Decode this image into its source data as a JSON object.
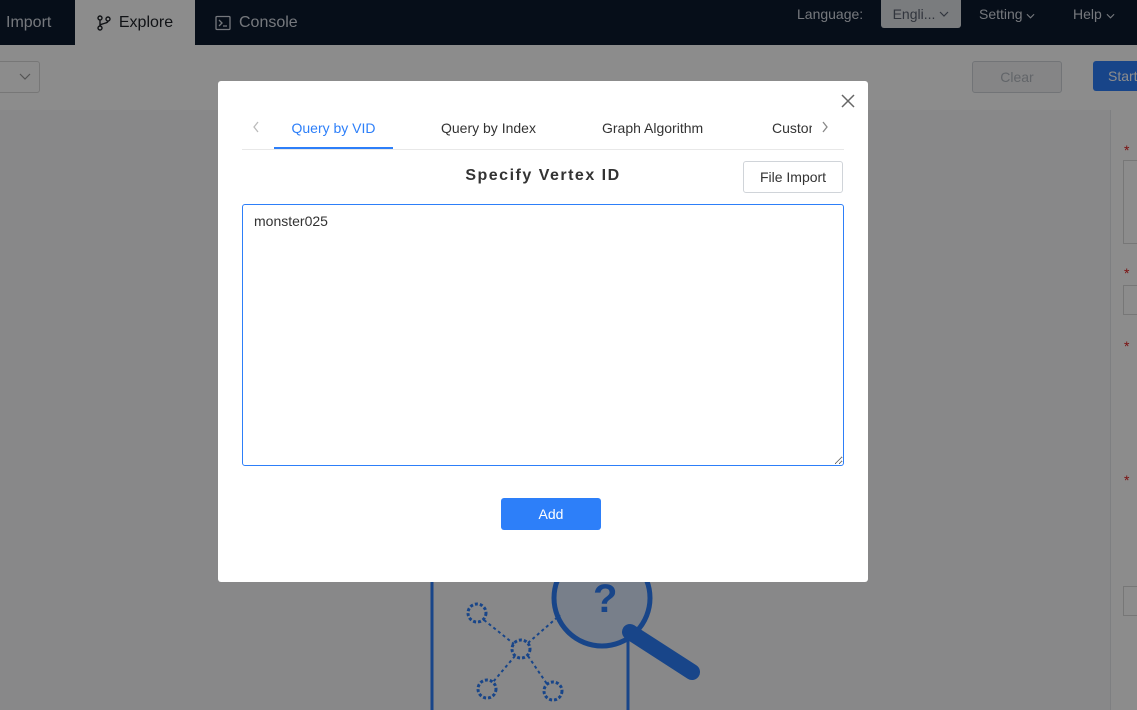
{
  "nav": {
    "import": "Import",
    "explore": "Explore",
    "console": "Console",
    "language_label": "Language:",
    "language_value": "Engli...",
    "setting": "Setting",
    "help": "Help"
  },
  "toolbar": {
    "clear": "Clear",
    "start": "Start"
  },
  "modal": {
    "tabs": [
      "Query by VID",
      "Query by Index",
      "Graph Algorithm",
      "Custom"
    ],
    "active_tab": "Query by VID",
    "title": "Specify Vertex ID",
    "file_import": "File Import",
    "vid_value": "monster025",
    "add": "Add"
  },
  "colors": {
    "accent": "#2d7ff9",
    "nav_bg": "#0c1a2e",
    "required": "#e02020"
  }
}
